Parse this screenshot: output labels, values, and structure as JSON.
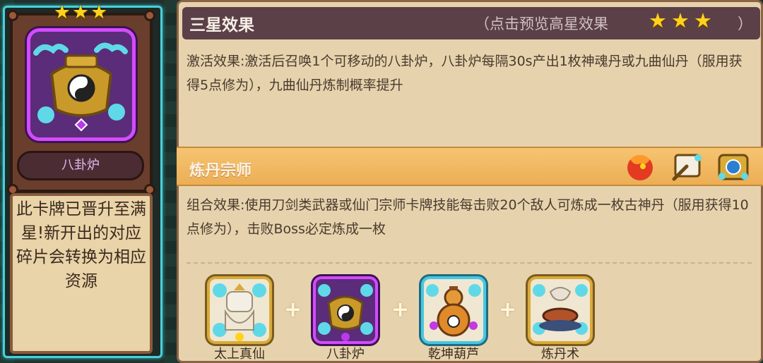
{
  "card": {
    "stars": "★★★",
    "name": "八卦炉",
    "note": "此卡牌已晋升至满星!新开出的对应碎片会转换为相应资源"
  },
  "effect_panel": {
    "title": "三星效果",
    "hint": "（点击预览高星效果",
    "stars": "★★★",
    "hint_close": "）",
    "description": "激活效果:激活后召唤1个可移动的八卦炉，八卦炉每隔30s产出1枚神魂丹或九曲仙丹（服用获得5点修为），九曲仙丹炼制概率提升"
  },
  "combo_panel": {
    "title": "炼丹宗师",
    "description": "组合效果:使用刀剑类武器或仙门宗师卡牌技能每击败20个敌人可炼成一枚古神丹（服用获得10点修为），击败Boss必定炼成一枚",
    "plus": "+",
    "cards": [
      {
        "name": "太上真仙",
        "icon": "immortal-icon"
      },
      {
        "name": "八卦炉",
        "icon": "bagua-furnace-icon"
      },
      {
        "name": "乾坤葫芦",
        "icon": "gourd-icon"
      },
      {
        "name": "炼丹术",
        "icon": "alchemy-icon"
      }
    ],
    "mini_icons": [
      "phoenix-icon",
      "scroll-icon",
      "mirror-icon"
    ]
  },
  "colors": {
    "gold_star": "#ffd21c",
    "header_dark": "#5c4048",
    "header_orange": "#f0b75e",
    "parchment": "#e6d3ad",
    "purple_frame": "#d44bff",
    "cyan_frame": "#49d0d8"
  }
}
